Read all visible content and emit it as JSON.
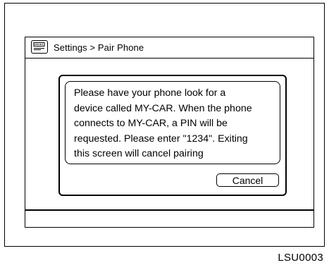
{
  "header": {
    "icon": "settings-keyboard-icon",
    "breadcrumb": "Settings > Pair Phone"
  },
  "dialog": {
    "message_lines": [
      "Please have your phone look for a",
      "device called MY-CAR. When the phone",
      "connects to MY-CAR, a PIN will be",
      "requested. Please enter \"1234\". Exiting",
      "this screen will cancel pairing"
    ],
    "cancel_label": "Cancel"
  },
  "figure_code": "LSU0003"
}
